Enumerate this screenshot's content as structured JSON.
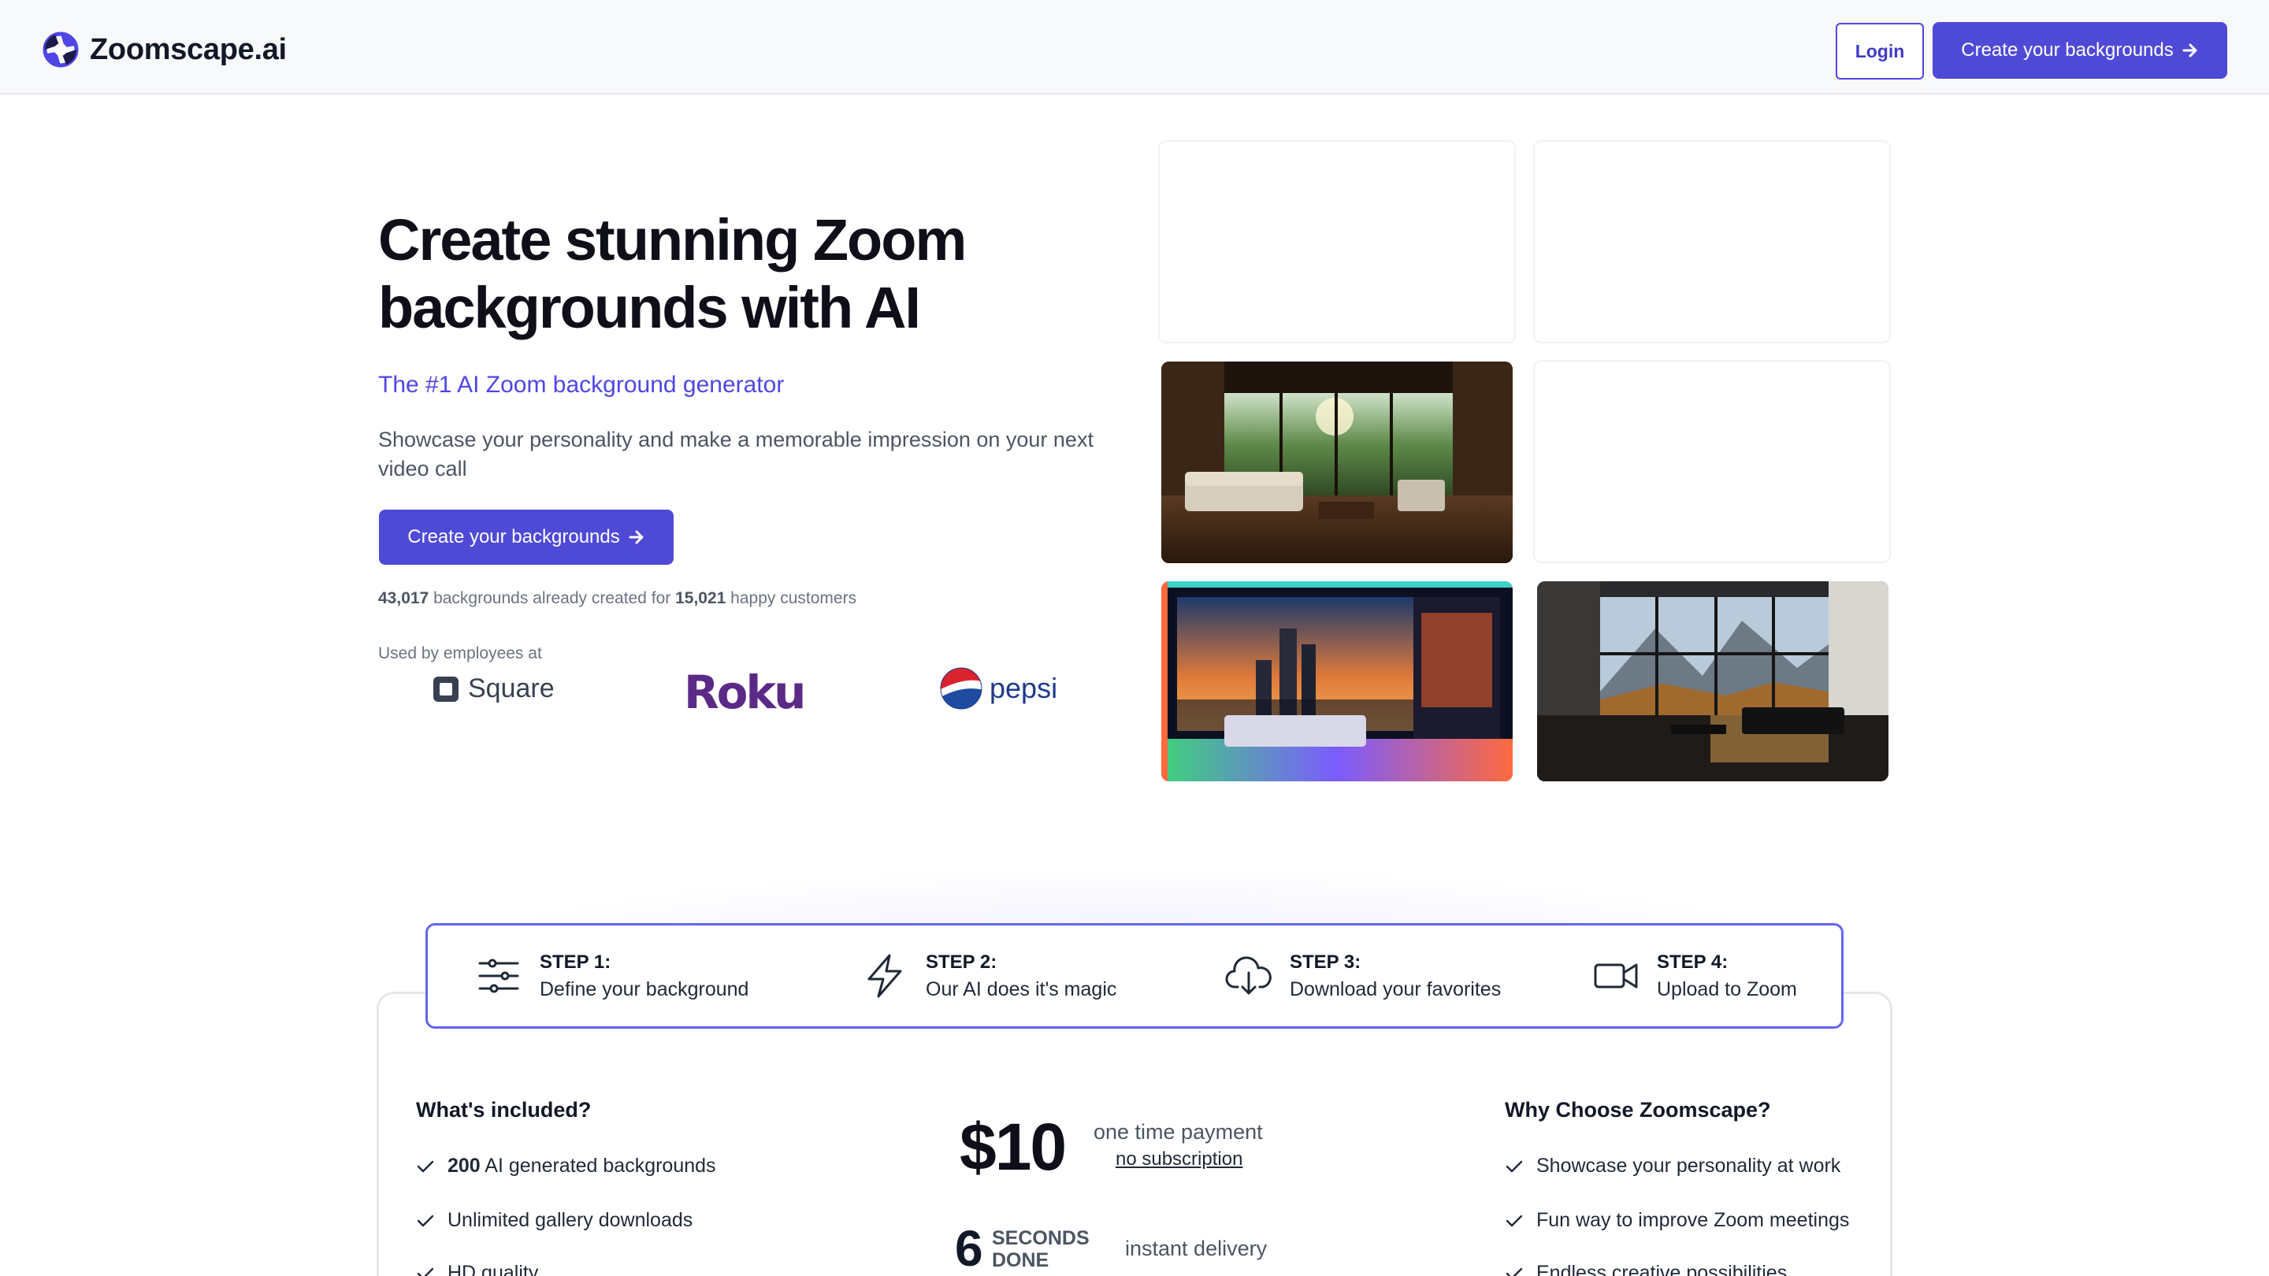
{
  "header": {
    "brand": "Zoomscape.ai",
    "login_label": "Login",
    "create_label": "Create your backgrounds"
  },
  "hero": {
    "title": "Create stunning Zoom backgrounds with AI",
    "subtitle": "The #1 AI Zoom background generator",
    "description": "Showcase your personality and make a memorable impression on your next video call",
    "cta_label": "Create your backgrounds",
    "stats": {
      "backgrounds_count": "43,017",
      "middle_text": " backgrounds already created for ",
      "customers_count": "15,021",
      "end_text": " happy customers"
    },
    "used_by_label": "Used by employees at",
    "logos": [
      "Square",
      "Roku",
      "pepsi"
    ]
  },
  "gallery": {
    "tiles": [
      {
        "state": "empty"
      },
      {
        "state": "empty"
      },
      {
        "state": "image",
        "scene": "tropical-living-room"
      },
      {
        "state": "empty"
      },
      {
        "state": "image",
        "scene": "neon-city-bedroom"
      },
      {
        "state": "image",
        "scene": "mountain-view-loft"
      }
    ]
  },
  "steps": [
    {
      "label": "STEP 1:",
      "text": "Define your background",
      "icon": "sliders-icon"
    },
    {
      "label": "STEP 2:",
      "text": "Our AI does it's magic",
      "icon": "lightning-icon"
    },
    {
      "label": "STEP 3:",
      "text": "Download your favorites",
      "icon": "cloud-download-icon"
    },
    {
      "label": "STEP 4:",
      "text": "Upload to Zoom",
      "icon": "video-camera-icon"
    }
  ],
  "included": {
    "heading": "What's included?",
    "items": [
      {
        "bold": "200",
        "text": " AI generated backgrounds"
      },
      {
        "bold": "",
        "text": "Unlimited gallery downloads"
      },
      {
        "bold": "",
        "text": "HD quality"
      }
    ]
  },
  "pricing": {
    "price": "$10",
    "note": "one time payment",
    "link": "no subscription",
    "seconds_number": "6",
    "seconds_line1": "SECONDS",
    "seconds_line2": "DONE",
    "delivery": "instant delivery"
  },
  "why": {
    "heading": "Why Choose Zoomscape?",
    "items": [
      "Showcase your personality at work",
      "Fun way to improve Zoom meetings",
      "Endless creative possibilities"
    ]
  },
  "colors": {
    "accent": "#4f4ad6",
    "accent_border": "#6366f1",
    "roku": "#5b2a86"
  }
}
